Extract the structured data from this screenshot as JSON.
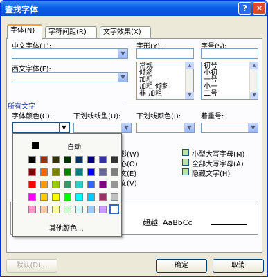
{
  "window": {
    "title": "查找字体",
    "help": "?",
    "close": "✕"
  },
  "tabs": [
    "字体(N)",
    "字符间距(R)",
    "文字效果(X)"
  ],
  "labels": {
    "cn_font": "中文字体(T):",
    "style": "字形(Y):",
    "size": "字号(S):",
    "west_font": "西文字体(F):",
    "all_text": "所有文字",
    "font_color": "字体颜色(C):",
    "underline": "下划线线型(U):",
    "underline_color": "下划线颜色(I):",
    "emphasis": "着重号:"
  },
  "style_list": [
    "常规",
    "倾斜",
    "加粗",
    "加粗 倾斜",
    "非 加粗"
  ],
  "size_list": [
    "初号",
    "小初",
    "一号",
    "小一",
    "二号"
  ],
  "effects_left": [
    "阴影(W)",
    "空心(O)",
    "阳文(E)",
    "阴文(V)"
  ],
  "effects_right": [
    "小型大写字母(M)",
    "全部大写字母(A)",
    "隐藏文字(H)"
  ],
  "preview": {
    "text1": "超越",
    "text2": "AaBbCc"
  },
  "popup": {
    "automatic": "自动",
    "more_colors": "其他颜色...",
    "colors": [
      [
        "#000000",
        "#993300",
        "#333300",
        "#003300",
        "#003366",
        "#000080",
        "#333399",
        "#333333"
      ],
      [
        "#800000",
        "#ff6600",
        "#808000",
        "#008000",
        "#008080",
        "#0000ff",
        "#666699",
        "#808080"
      ],
      [
        "#ff0000",
        "#ff9900",
        "#99cc00",
        "#339966",
        "#33cccc",
        "#3366ff",
        "#800080",
        "#969696"
      ],
      [
        "#ff00ff",
        "#ffcc00",
        "#ffff00",
        "#00ff00",
        "#00ffff",
        "#00ccff",
        "#993366",
        "#c0c0c0"
      ],
      [
        "#ff99cc",
        "#ffcc99",
        "#ffff99",
        "#ccffcc",
        "#ccffff",
        "#99ccff",
        "#cc99ff",
        "#ffffff"
      ]
    ]
  },
  "buttons": {
    "default": "默认(D)...",
    "ok": "确定",
    "cancel": "取消"
  }
}
